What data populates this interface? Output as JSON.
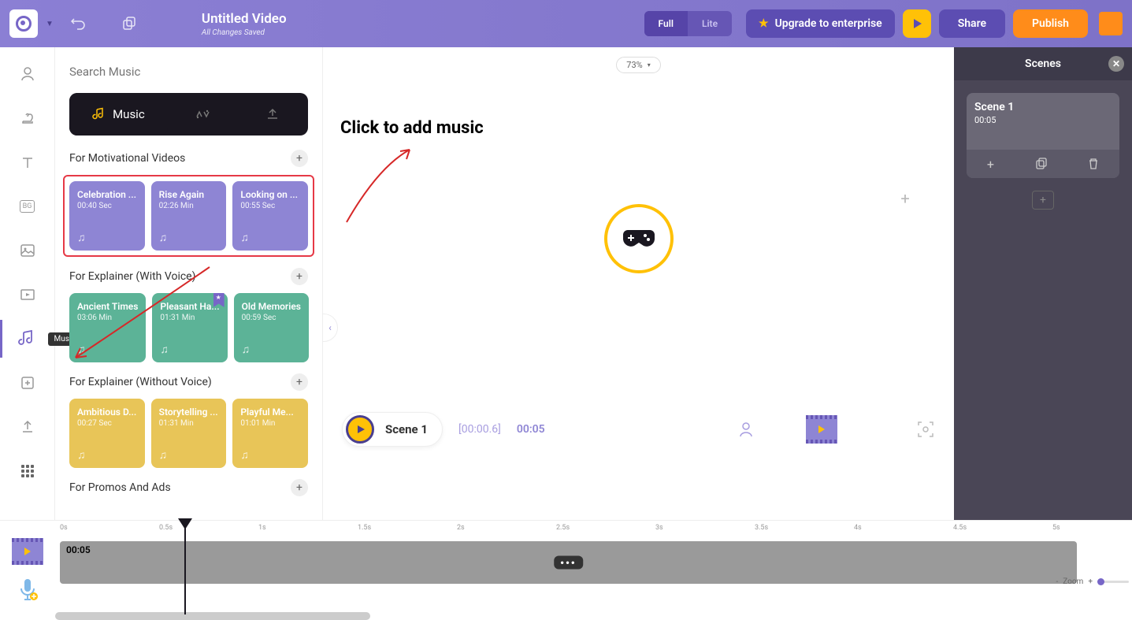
{
  "header": {
    "title": "Untitled Video",
    "saved": "All Changes Saved",
    "mode_full": "Full",
    "mode_lite": "Lite",
    "upgrade": "Upgrade to enterprise",
    "share": "Share",
    "publish": "Publish"
  },
  "sidebar": {
    "tooltip": "Music"
  },
  "music": {
    "search_placeholder": "Search Music",
    "tab_label": "Music",
    "categories": [
      {
        "title": "For Motivational Videos",
        "color": "purple",
        "highlight": true,
        "tracks": [
          {
            "name": "Celebration ...",
            "duration": "00:40 Sec"
          },
          {
            "name": "Rise Again",
            "duration": "02:26 Min"
          },
          {
            "name": "Looking on ...",
            "duration": "00:55 Sec"
          }
        ]
      },
      {
        "title": "For Explainer (With Voice)",
        "color": "green",
        "tracks": [
          {
            "name": "Ancient Times",
            "duration": "03:06 Min"
          },
          {
            "name": "Pleasant Ha...",
            "duration": "01:31 Min",
            "starred": true
          },
          {
            "name": "Old Memories",
            "duration": "00:59 Sec"
          }
        ]
      },
      {
        "title": "For Explainer (Without Voice)",
        "color": "yellow",
        "tracks": [
          {
            "name": "Ambitious D...",
            "duration": "00:27 Sec"
          },
          {
            "name": "Storytelling ...",
            "duration": "01:31 Min"
          },
          {
            "name": "Playful Me...",
            "duration": "01:01 Min"
          }
        ]
      },
      {
        "title": "For Promos And Ads",
        "color": "purple",
        "tracks": []
      }
    ]
  },
  "canvas": {
    "zoom": "73%",
    "scene_label": "Scene 1",
    "time_elapsed": "[00:00.6]",
    "time_total": "00:05"
  },
  "scenes": {
    "title": "Scenes",
    "items": [
      {
        "name": "Scene 1",
        "time": "00:05"
      }
    ]
  },
  "timeline": {
    "marks": [
      "0s",
      "0.5s",
      "1s",
      "1.5s",
      "2s",
      "2.5s",
      "3s",
      "3.5s",
      "4s",
      "4.5s",
      "5s"
    ],
    "clip_label": "00:05",
    "zoom_label": "Zoom"
  },
  "annotation": "Click to add music"
}
